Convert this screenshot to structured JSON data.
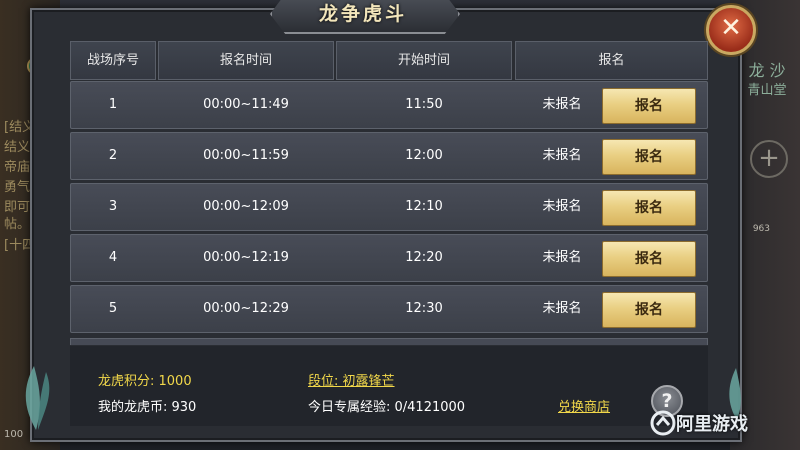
{
  "dialog": {
    "title": "龙争虎斗",
    "close_symbol": "✕"
  },
  "table": {
    "headers": [
      "战场序号",
      "报名时间",
      "开始时间",
      "报名"
    ],
    "rows": [
      {
        "index": "1",
        "reg_time": "00:00~11:49",
        "start_time": "11:50",
        "status": "未报名",
        "button": "报名"
      },
      {
        "index": "2",
        "reg_time": "00:00~11:59",
        "start_time": "12:00",
        "status": "未报名",
        "button": "报名"
      },
      {
        "index": "3",
        "reg_time": "00:00~12:09",
        "start_time": "12:10",
        "status": "未报名",
        "button": "报名"
      },
      {
        "index": "4",
        "reg_time": "00:00~12:19",
        "start_time": "12:20",
        "status": "未报名",
        "button": "报名"
      },
      {
        "index": "5",
        "reg_time": "00:00~12:29",
        "start_time": "12:30",
        "status": "未报名",
        "button": "报名"
      }
    ]
  },
  "footer": {
    "points": "龙虎积分: 1000",
    "coins": "我的龙虎币: 930",
    "rank": "段位: 初露锋芒",
    "exp": "今日专属经验: 0/4121000",
    "shop": "兑换商店",
    "help_symbol": "?"
  },
  "background": {
    "left_lines": [
      "结义",
      "帝庙",
      "勇气",
      "即可",
      "帖。",
      "[十四"
    ],
    "left_tag": "[结义]",
    "right_lines": [
      "龙 沙",
      "青山堂"
    ],
    "right_plus": "+",
    "left_num": "100",
    "right_num": "963"
  },
  "watermark": "阿里游戏",
  "colors": {
    "accent_gold": "#f2d84a",
    "button_gold": "#e9cf82",
    "close_red": "#c4462a"
  },
  "icons": [
    "close-icon",
    "help-icon",
    "jade-ornament-icon",
    "leaf-ornament-icon",
    "watermark-logo-icon"
  ]
}
